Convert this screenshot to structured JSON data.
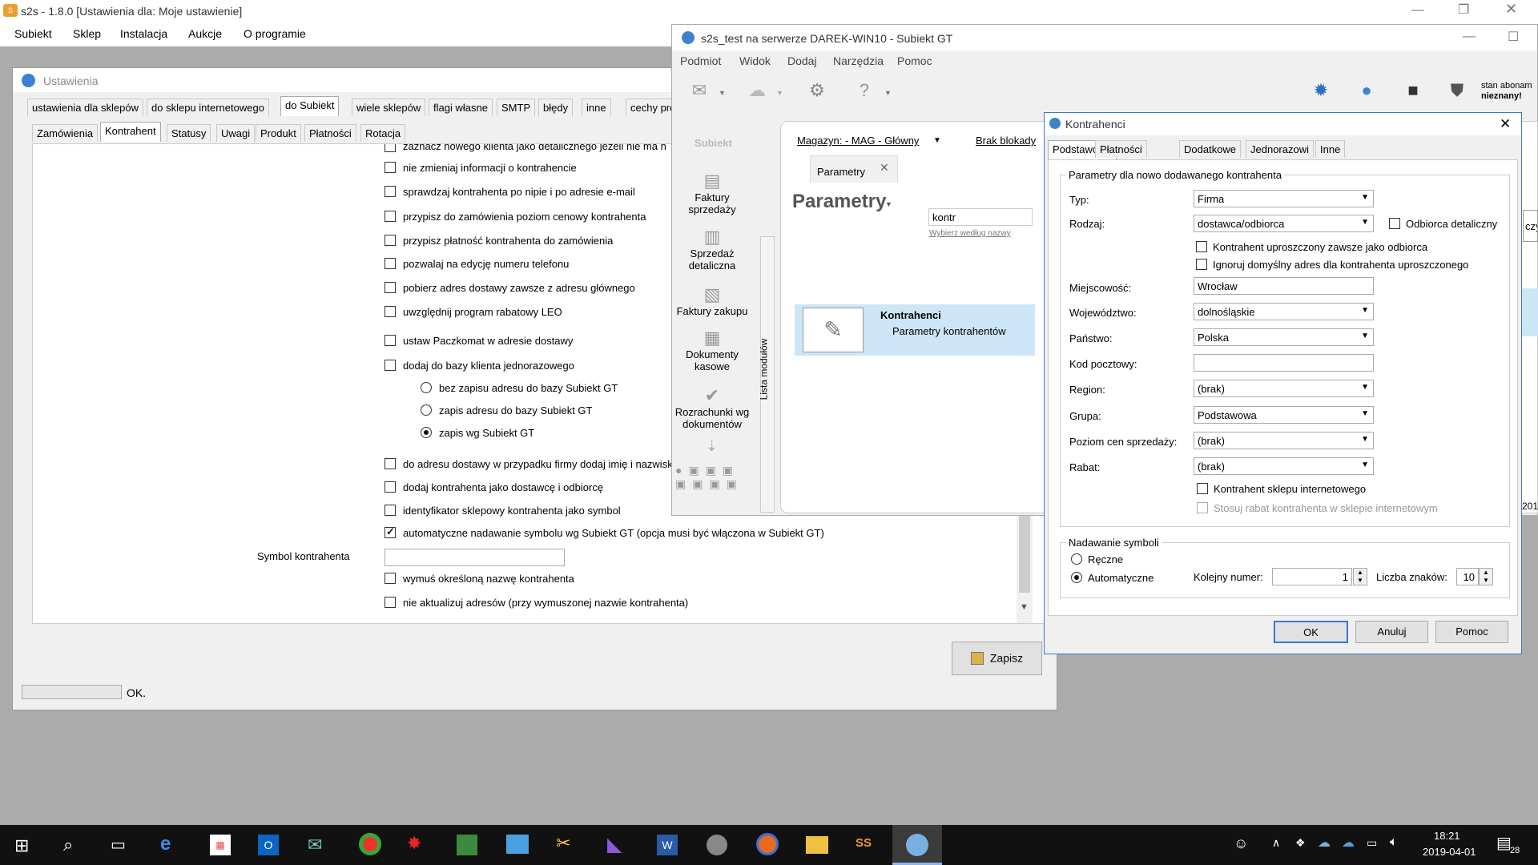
{
  "main_window": {
    "title": "s2s - 1.8.0 [Ustawienia dla: Moje ustawienie]",
    "menu": [
      "Subiekt",
      "Sklep",
      "Instalacja",
      "Aukcje",
      "O programie"
    ]
  },
  "settings": {
    "title": "Ustawienia",
    "tabs_top": [
      "ustawienia dla sklepów",
      "do sklepu internetowego",
      "do Subiekt",
      "wiele sklepów",
      "flagi własne",
      "SMTP",
      "błędy",
      "inne",
      "cechy produ"
    ],
    "tabs_sub": [
      "Zamówienia",
      "Kontrahent",
      "Statusy",
      "Uwagi",
      "Produkt",
      "Płatności",
      "Rotacja"
    ],
    "options": [
      {
        "label": "zaznacz nowego klienta jako detalicznego jeżeli nie ma n",
        "checked": false
      },
      {
        "label": "nie zmieniaj informacji o kontrahencie",
        "checked": false
      },
      {
        "label": "sprawdzaj kontrahenta po nipie i po adresie e-mail",
        "checked": false
      },
      {
        "label": "przypisz do zamówienia poziom cenowy kontrahenta",
        "checked": false
      },
      {
        "label": "przypisz płatność kontrahenta do zamówienia",
        "checked": false
      },
      {
        "label": "pozwalaj na edycję numeru telefonu",
        "checked": false
      },
      {
        "label": "pobierz adres dostawy zawsze z adresu głównego",
        "checked": false
      },
      {
        "label": "uwzględnij program rabatowy LEO",
        "checked": false
      },
      {
        "label": "ustaw Paczkomat w adresie dostawy",
        "checked": false
      },
      {
        "label": "dodaj do bazy klienta jednorazowego",
        "checked": false
      }
    ],
    "radios": [
      {
        "label": "bez zapisu adresu do bazy Subiekt GT",
        "checked": false
      },
      {
        "label": "zapis adresu do bazy Subiekt GT",
        "checked": false
      },
      {
        "label": "zapis wg Subiekt GT",
        "checked": true
      }
    ],
    "options2": [
      {
        "label": "do adresu dostawy w przypadku firmy dodaj imię i nazwisk",
        "checked": false
      },
      {
        "label": "dodaj kontrahenta jako dostawcę i odbiorcę",
        "checked": false
      },
      {
        "label": "identyfikator sklepowy kontrahenta jako symbol",
        "checked": false
      },
      {
        "label": "automatyczne nadawanie symbolu wg Subiekt GT (opcja musi być włączona w Subiekt GT)",
        "checked": true
      }
    ],
    "symbol_label": "Symbol kontrahenta",
    "symbol_value": "",
    "options3": [
      {
        "label": "wymuś określoną nazwę kontrahenta",
        "checked": false
      },
      {
        "label": "nie aktualizuj adresów (przy wymuszonej nazwie kontrahenta)",
        "checked": false
      }
    ],
    "save_label": "Zapisz",
    "status_text": "OK."
  },
  "subiekt": {
    "title": "s2s_test na serwerze DAREK-WIN10 - Subiekt GT",
    "menu": [
      "Podmiot",
      "Widok",
      "Dodaj",
      "Narzędzia",
      "Pomoc"
    ],
    "stan_line1": "stan abonam",
    "stan_line2": "nieznany!",
    "logo_text": "Subiekt",
    "magazyn": "Magazyn: - MAG - Główny",
    "blokady": "Brak blokady",
    "tab_label": "Parametry",
    "heading": "Parametry",
    "search_value": "kontr",
    "search_hint": "Wybierz według nazwy",
    "result_title": "Kontrahenci",
    "result_sub": "Parametry kontrahentów",
    "modules_label": "Lista modułów",
    "modules": [
      {
        "line1": "Faktury",
        "line2": "sprzedaży"
      },
      {
        "line1": "Sprzedaż",
        "line2": "detaliczna"
      },
      {
        "line1": "Faktury zakupu",
        "line2": ""
      },
      {
        "line1": "Dokumenty",
        "line2": "kasowe"
      },
      {
        "line1": "Rozrachunki wg",
        "line2": "dokumentów"
      }
    ]
  },
  "dialog": {
    "title": "Kontrahenci",
    "tabs": [
      "Podstawowe",
      "Płatności",
      "Dodatkowe",
      "Jednorazowi",
      "Inne"
    ],
    "group1": "Parametry dla nowo dodawanego kontrahenta",
    "typ_label": "Typ:",
    "typ_value": "Firma",
    "rodzaj_label": "Rodzaj:",
    "rodzaj_value": "dostawca/odbiorca",
    "odbiorca_detaliczny": "Odbiorca detaliczny",
    "uproszczony": "Kontrahent uproszczony zawsze jako odbiorca",
    "ignoruj": "Ignoruj domyślny adres dla kontrahenta uproszczonego",
    "miejscowosc_label": "Miejscowość:",
    "miejscowosc_value": "Wrocław",
    "wojewodztwo_label": "Województwo:",
    "wojewodztwo_value": "dolnośląskie",
    "panstwo_label": "Państwo:",
    "panstwo_value": "Polska",
    "kod_label": "Kod pocztowy:",
    "kod_value": "",
    "region_label": "Region:",
    "region_value": "(brak)",
    "grupa_label": "Grupa:",
    "grupa_value": "Podstawowa",
    "poziom_label": "Poziom cen sprzedaży:",
    "poziom_value": "(brak)",
    "rabat_label": "Rabat:",
    "rabat_value": "(brak)",
    "sklep_internetowy": "Kontrahent sklepu internetowego",
    "stosuj_rabat": "Stosuj rabat kontrahenta w sklepie internetowym",
    "group2": "Nadawanie symboli",
    "reczne": "Ręczne",
    "automatyczne": "Automatyczne",
    "kolejny_label": "Kolejny numer:",
    "kolejny_value": "1",
    "liczba_label": "Liczba znaków:",
    "liczba_value": "10",
    "ok": "OK",
    "anuluj": "Anuluj",
    "pomoc": "Pomoc"
  },
  "behind": {
    "czy": "czy",
    "year": "201"
  },
  "taskbar": {
    "time": "18:21",
    "date": "2019-04-01",
    "notifications": "28"
  }
}
